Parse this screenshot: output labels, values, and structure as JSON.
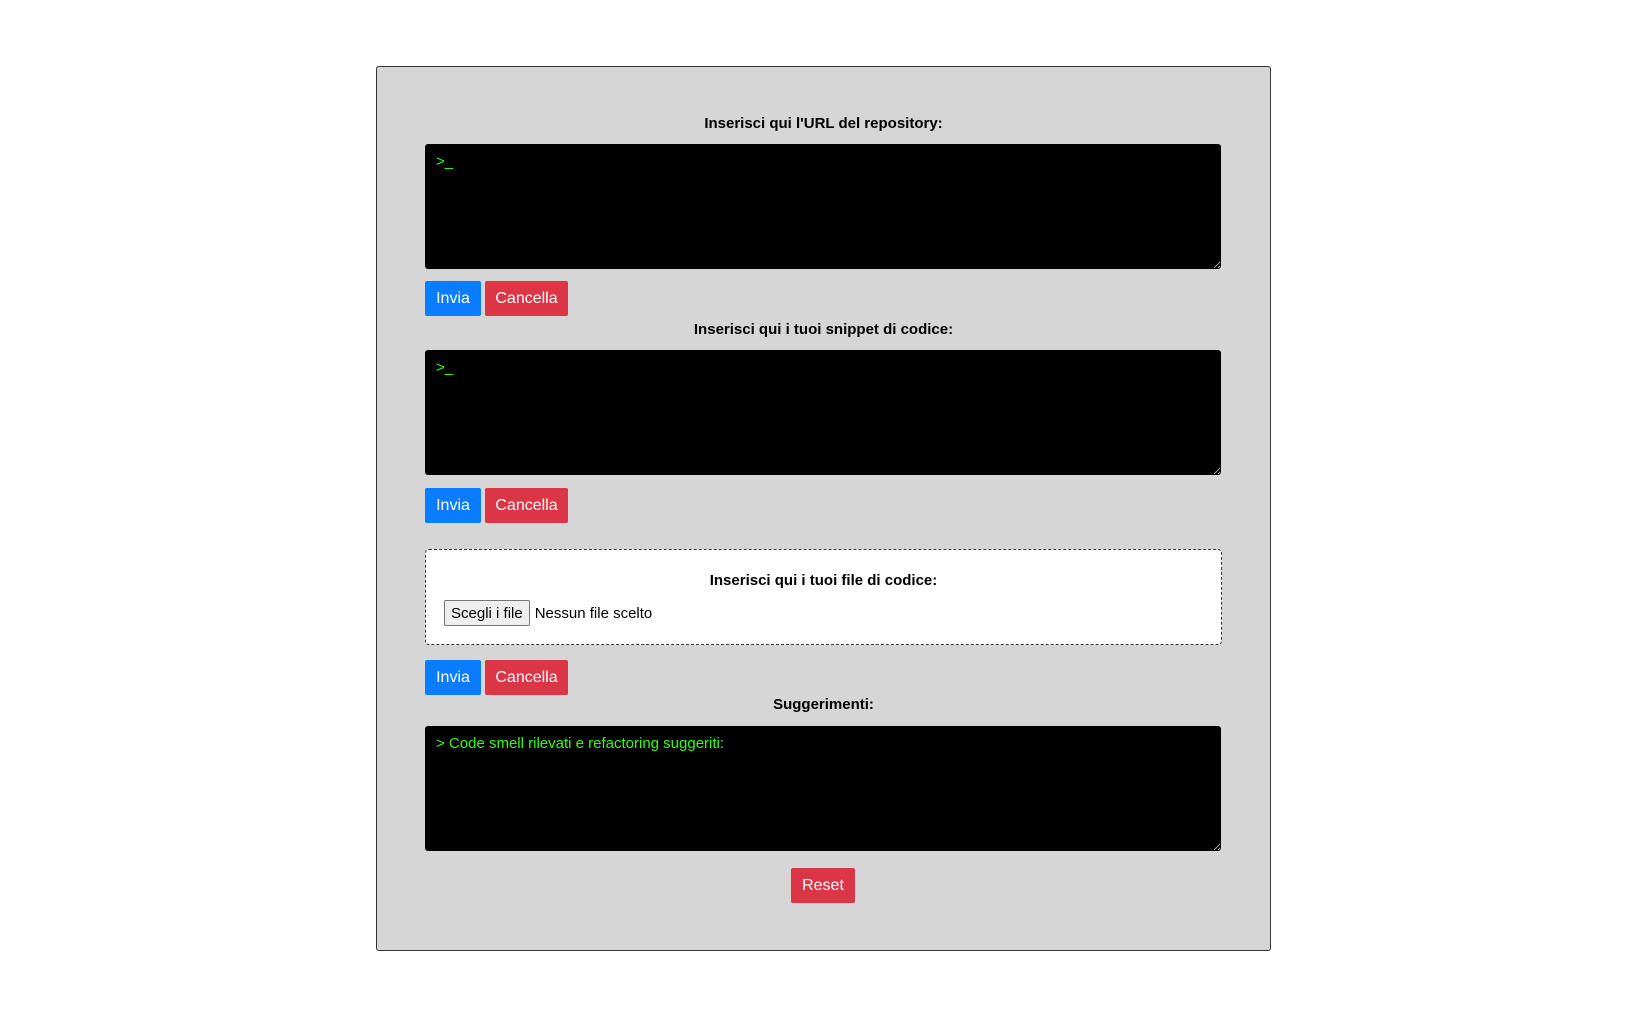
{
  "repo_section": {
    "label": "Inserisci qui l'URL del repository:",
    "placeholder": ">_",
    "value": "",
    "submit_label": "Invia",
    "clear_label": "Cancella"
  },
  "snippet_section": {
    "label": "Inserisci qui i tuoi snippet di codice:",
    "placeholder": ">_",
    "value": "",
    "submit_label": "Invia",
    "clear_label": "Cancella"
  },
  "file_section": {
    "label": "Inserisci qui i tuoi file di codice:",
    "choose_label": "Scegli i file",
    "status": "Nessun file scelto",
    "submit_label": "Invia",
    "clear_label": "Cancella"
  },
  "suggestions": {
    "label": "Suggerimenti:",
    "text": "> Code smell rilevati e refactoring suggeriti:",
    "reset_label": "Reset"
  },
  "colors": {
    "panel_bg": "#d6d6d6",
    "terminal_bg": "#000000",
    "terminal_text": "#33ff00",
    "primary": "#0a7cff",
    "danger": "#dc3545"
  }
}
